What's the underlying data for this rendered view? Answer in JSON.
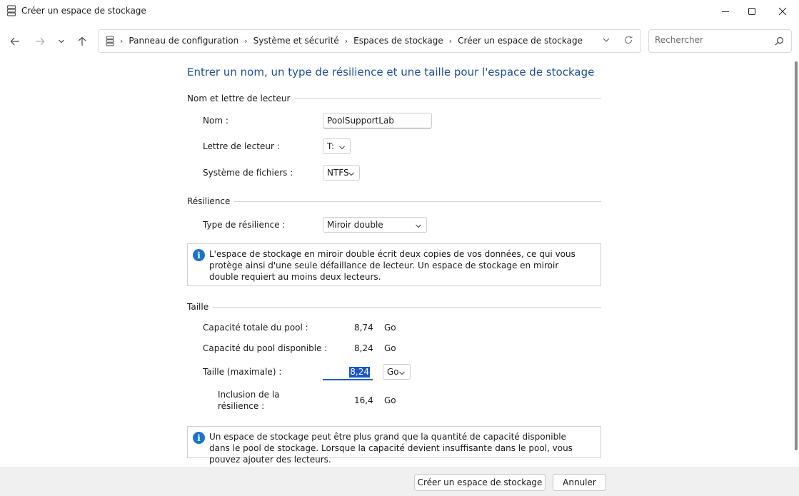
{
  "window": {
    "title": "Créer un espace de stockage"
  },
  "navigation": {
    "breadcrumbs": [
      "Panneau de configuration",
      "Système et sécurité",
      "Espaces de stockage",
      "Créer un espace de stockage"
    ],
    "search_placeholder": "Rechercher"
  },
  "page": {
    "heading": "Entrer un nom, un type de résilience et une taille pour l'espace de stockage"
  },
  "name_section": {
    "title": "Nom et lettre de lecteur",
    "name_label": "Nom :",
    "name_value": "PoolSupportLab",
    "drive_letter_label": "Lettre de lecteur :",
    "drive_letter_value": "T:",
    "filesystem_label": "Système de fichiers :",
    "filesystem_value": "NTFS"
  },
  "resilience_section": {
    "title": "Résilience",
    "type_label": "Type de résilience :",
    "type_value": "Miroir double",
    "info_text": "L'espace de stockage en miroir double écrit deux copies de vos données, ce qui vous protège ainsi d'une seule défaillance de lecteur. Un espace de stockage en miroir double requiert au moins deux lecteurs."
  },
  "size_section": {
    "title": "Taille",
    "total_capacity_label": "Capacité totale du pool :",
    "total_capacity_value": "8,74",
    "total_capacity_unit": "Go",
    "available_capacity_label": "Capacité du pool disponible :",
    "available_capacity_value": "8,24",
    "available_capacity_unit": "Go",
    "max_size_label": "Taille (maximale) :",
    "max_size_value": "8,24",
    "max_size_unit": "Go",
    "resilience_inclusion_label_line1": "Inclusion de la",
    "resilience_inclusion_label_line2": "résilience :",
    "resilience_inclusion_value": "16,4",
    "resilience_inclusion_unit": "Go",
    "info_text": "Un espace de stockage peut être plus grand que la quantité de capacité disponible dans le pool de stockage. Lorsque la capacité devient insuffisante dans le pool, vous pouvez ajouter des lecteurs."
  },
  "footer": {
    "create_button": "Créer un espace de stockage",
    "cancel_button": "Annuler"
  },
  "colors": {
    "heading": "#1e4e9a",
    "info_icon": "#1a73c7",
    "selection": "#1a56c5"
  }
}
